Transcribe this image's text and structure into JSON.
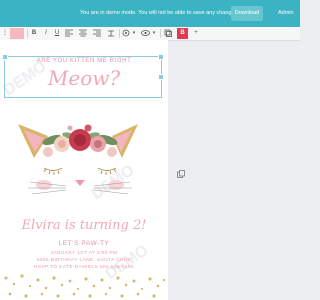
{
  "banner": {
    "message": "You are in demo mode. You will not be able to save any changes.",
    "download_label": "Download",
    "admin_label": "Admin"
  },
  "toolbar": {
    "bold": "B",
    "italic": "I",
    "underline": "U",
    "font_color_label": "B",
    "add": "+",
    "text_color": "#f5b8c0",
    "accent_color": "#e23b50"
  },
  "invitation": {
    "headline": "ARE YOU KITTEN ME RIGHT",
    "script_title": "Meow?",
    "name_line": "Elvira is turning 2!",
    "subtitle": "LET'S PAW-TY",
    "date_line": "JANUARY 1ST AT 2:00 PM",
    "address_line": "5555 BIRTHDAY LANE, SANTA CRUZ",
    "rsvp_line": "RSVP TO KATE DANIELS 555.555.5555",
    "watermark": "DEMO"
  },
  "icons": {
    "page_icon": "copy-icon"
  }
}
